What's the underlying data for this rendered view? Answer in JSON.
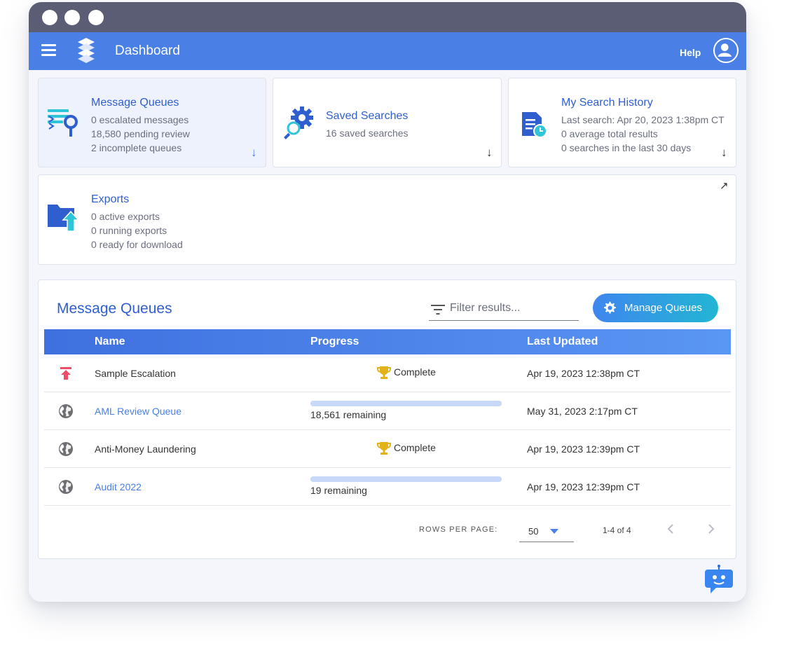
{
  "app": {
    "title": "Dashboard",
    "help_label": "Help"
  },
  "cards": {
    "message_queues": {
      "title": "Message Queues",
      "lines": [
        "0 escalated messages",
        "18,580 pending review",
        "2 incomplete queues"
      ],
      "arrow": "↓",
      "icon": "filter-search-icon"
    },
    "saved_searches": {
      "title": "Saved Searches",
      "lines": [
        "16 saved searches"
      ],
      "arrow": "↓",
      "icon": "gear-search-icon"
    },
    "search_history": {
      "title": "My Search History",
      "lines": [
        "Last search: Apr 20, 2023 1:38pm CT",
        "0 average total results",
        "0 searches in the last 30 days"
      ],
      "arrow": "↓",
      "icon": "document-clock-icon"
    },
    "exports": {
      "title": "Exports",
      "lines": [
        "0 active exports",
        "0 running exports",
        "0 ready for download"
      ],
      "arrow": "↗",
      "icon": "folder-upload-icon"
    }
  },
  "queues_panel": {
    "title": "Message Queues",
    "filter_placeholder": "Filter results...",
    "manage_label": "Manage Queues",
    "columns": [
      "Name",
      "Progress",
      "Last Updated"
    ],
    "rows": [
      {
        "icon": "escalation-arrow-icon",
        "name": "Sample Escalation",
        "status": "Complete",
        "updated": "Apr 19, 2023 12:38pm CT",
        "link": false
      },
      {
        "icon": "globe-icon",
        "name": "AML Review Queue",
        "remaining_text": "18,561 remaining",
        "progress": 0.0,
        "updated": "May 31, 2023 2:17pm CT",
        "link": true
      },
      {
        "icon": "globe-icon",
        "name": "Anti-Money Laundering",
        "status": "Complete",
        "updated": "Apr 19, 2023 12:39pm CT",
        "link": false
      },
      {
        "icon": "globe-icon",
        "name": "Audit 2022",
        "remaining_text": "19 remaining",
        "progress": 0.0,
        "updated": "Apr 19, 2023 12:39pm CT",
        "link": true
      }
    ],
    "pagination": {
      "rows_per_page_label": "ROWS PER PAGE:",
      "rows_per_page": "50",
      "range": "1-4 of 4"
    }
  },
  "colors": {
    "appbar": "#4a7fe6",
    "accent": "#2f5fcf",
    "titlebar": "#5a5d73",
    "trophy": "#e3b21a",
    "escalation": "#ee4d6a"
  }
}
